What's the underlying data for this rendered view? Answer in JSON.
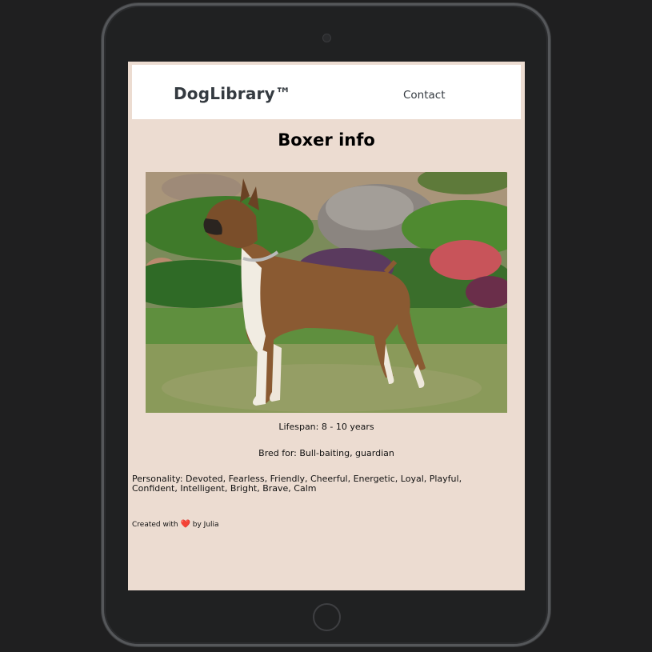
{
  "navbar": {
    "brand": "DogLibrary™",
    "contact_label": "Contact"
  },
  "main": {
    "title": "Boxer info",
    "image_alt": "Boxer",
    "lifespan": "Lifespan: 8 - 10 years",
    "bred_for": "Bred for: Bull-baiting, guardian",
    "personality": "Personality: Devoted, Fearless, Friendly, Cheerful, Energetic, Loyal, Playful, Confident, Intelligent, Bright, Brave, Calm"
  },
  "footer": {
    "prefix": "Created with",
    "heart_icon": "heart-icon",
    "suffix": "by Julia"
  },
  "colors": {
    "page_background": "#ecdcd1",
    "navbar_background": "#ffffff",
    "text_dark": "#343a40",
    "heart": "#e0212a"
  }
}
